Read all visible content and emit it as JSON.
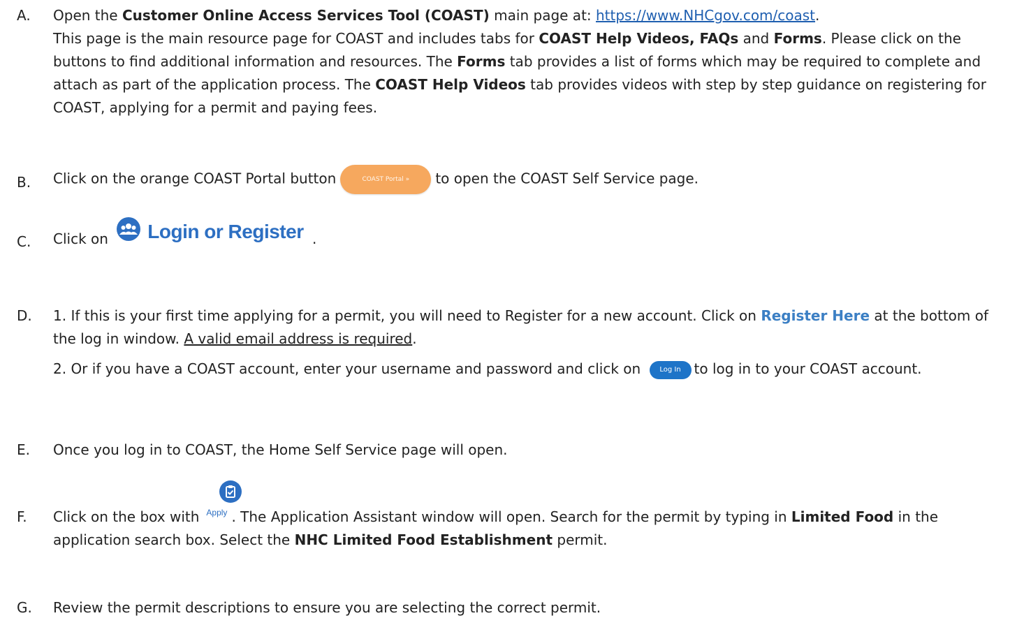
{
  "steps": {
    "a": {
      "letter": "A.",
      "t1": "Open the ",
      "b1": "Customer Online Access Services Tool (COAST)",
      "t2": " main page at: ",
      "link": "https://www.NHCgov.com/coast",
      "t3": ".",
      "t4": "This page is the main resource page for COAST and includes tabs for ",
      "b2": "COAST Help Videos, FAQs",
      "t5": " and ",
      "b3": "Forms",
      "t6": ". Please click on the buttons to find additional information and resources. The ",
      "b4": "Forms",
      "t7": " tab provides a list of forms which may be required to complete and attach as part of the application process. The ",
      "b5": "COAST Help Videos",
      "t8": " tab provides videos with step by step guidance on registering for COAST, applying for a permit and paying fees."
    },
    "b": {
      "letter": "B.",
      "t1": "Click on the orange COAST Portal button",
      "button": "COAST Portal »",
      "t2": "to open the COAST Self Service page."
    },
    "c": {
      "letter": "C.",
      "t1": "Click on",
      "login_label": "Login or Register",
      "t2": "."
    },
    "d": {
      "letter": "D.",
      "t1": "1. If this is your first time applying for a permit, you will need to Register for a new account. Click on ",
      "blue": "Register Here",
      "t2": " at the bottom of the log in window. ",
      "underline": "A valid email address is required",
      "t3": ".",
      "t4": "2. Or if you have a COAST account, enter your username and password and click on ",
      "button": "Log In",
      "t5": "to log in to your COAST account."
    },
    "e": {
      "letter": "E.",
      "t1": "Once you log in to COAST, the Home Self Service page will open."
    },
    "f": {
      "letter": "F.",
      "t1": "Click on the box with",
      "apply": "Apply",
      "t2": ". The Application Assistant window will open. Search for the permit by typing in ",
      "b1": "Limited Food",
      "t3": " in the application search box. Select the ",
      "b2": "NHC Limited Food Establishment",
      "t4": " permit."
    },
    "g": {
      "letter": "G.",
      "t1": "Review the permit descriptions to ensure you are selecting the correct permit."
    }
  },
  "colors": {
    "coast_button": "#f6a85e",
    "accent_blue": "#2d6fc2",
    "link": "#1f5fb0"
  },
  "icons": {
    "login": "users-group-icon",
    "apply": "clipboard-check-icon"
  }
}
